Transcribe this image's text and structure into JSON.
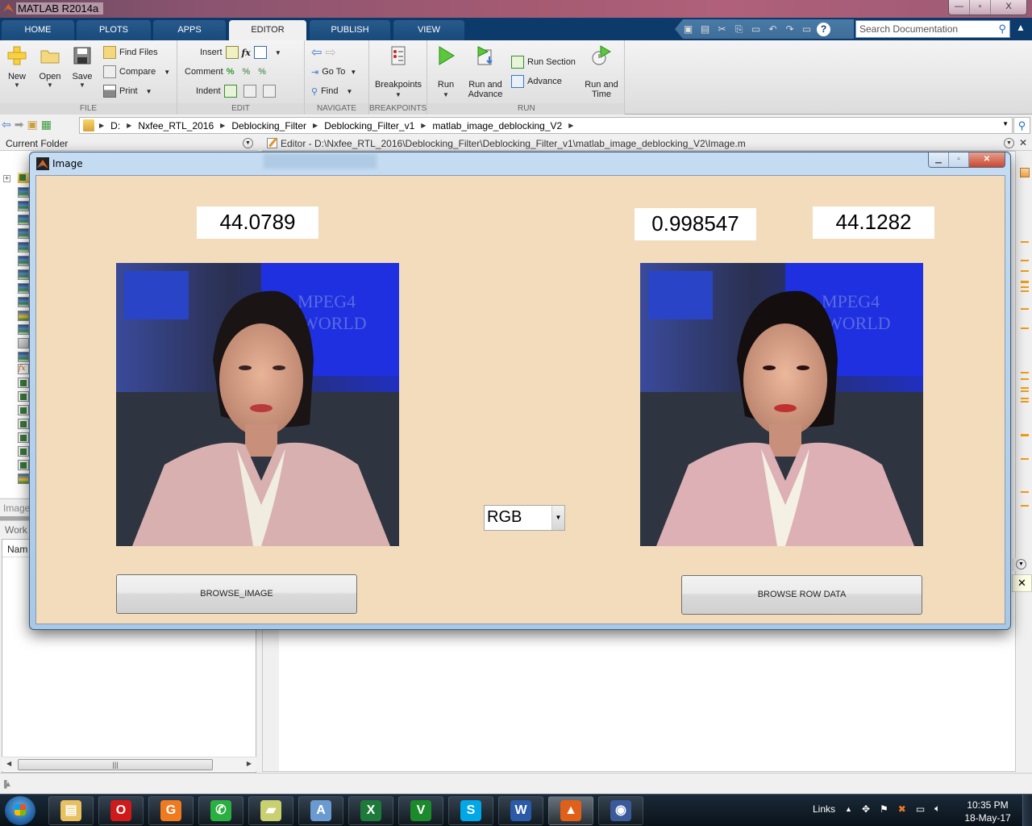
{
  "app": {
    "title": "MATLAB R2014a",
    "window_controls": {
      "minimize": "—",
      "restore": "▫",
      "close": "X"
    }
  },
  "ribbon": {
    "tabs": [
      {
        "label": "HOME",
        "active": false
      },
      {
        "label": "PLOTS",
        "active": false
      },
      {
        "label": "APPS",
        "active": false
      },
      {
        "label": "EDITOR",
        "active": true
      },
      {
        "label": "PUBLISH",
        "active": false
      },
      {
        "label": "VIEW",
        "active": false
      }
    ],
    "search_placeholder": "Search Documentation",
    "sections": {
      "file": {
        "label": "FILE",
        "new": "New",
        "open": "Open",
        "save": "Save",
        "find_files": "Find Files",
        "compare": "Compare",
        "print": "Print"
      },
      "edit": {
        "label": "EDIT",
        "insert": "Insert",
        "comment": "Comment",
        "indent": "Indent",
        "fx": "fx"
      },
      "navigate": {
        "label": "NAVIGATE",
        "go_to": "Go To",
        "find": "Find"
      },
      "breakpoints": {
        "label": "BREAKPOINTS",
        "breakpoints": "Breakpoints"
      },
      "run": {
        "label": "RUN",
        "run": "Run",
        "run_and_advance_1": "Run and",
        "run_and_advance_2": "Advance",
        "run_section": "Run Section",
        "advance": "Advance",
        "run_and_time_1": "Run and",
        "run_and_time_2": "Time"
      }
    }
  },
  "address_bar": {
    "path": [
      "D:",
      "Nxfee_RTL_2016",
      "Deblocking_Filter",
      "Deblocking_Filter_v1",
      "matlab_image_deblocking_V2"
    ]
  },
  "current_folder": {
    "title": "Current Folder",
    "details_label": "Image",
    "workspace_label": "Work",
    "workspace_column": "Nam"
  },
  "editor": {
    "title": "Editor - D:\\Nxfee_RTL_2016\\Deblocking_Filter\\Deblocking_Filter_v1\\matlab_image_deblocking_V2\\Image.m"
  },
  "figure": {
    "title": "Image",
    "background_color": "#f2dcbc",
    "left_value": "44.0789",
    "middle_value": "0.998547",
    "right_value": "44.1282",
    "color_mode": "RGB",
    "browse_image_label": "BROWSE_IMAGE",
    "browse_row_data_label": "BROWSE ROW DATA",
    "left_image_desc": "Original news anchor image",
    "right_image_desc": "Deblocked news anchor image"
  },
  "taskbar": {
    "apps": [
      {
        "name": "file-explorer",
        "glyph": "▤",
        "color": "#e8c060"
      },
      {
        "name": "opera",
        "glyph": "O",
        "color": "#d01a1a"
      },
      {
        "name": "foxit-pdf",
        "glyph": "G",
        "color": "#f07a20"
      },
      {
        "name": "whatsapp",
        "glyph": "✆",
        "color": "#2ab040"
      },
      {
        "name": "sticky-notes",
        "glyph": "▰",
        "color": "#c8d070"
      },
      {
        "name": "wordpad",
        "glyph": "A",
        "color": "#6a9ad0"
      },
      {
        "name": "excel",
        "glyph": "X",
        "color": "#1e7a3a"
      },
      {
        "name": "vim",
        "glyph": "V",
        "color": "#1a8a2a"
      },
      {
        "name": "skype",
        "glyph": "S",
        "color": "#00a8e8"
      },
      {
        "name": "word",
        "glyph": "W",
        "color": "#2a5aa8"
      },
      {
        "name": "matlab",
        "glyph": "▲",
        "color": "#e0601a"
      },
      {
        "name": "media-player",
        "glyph": "◉",
        "color": "#3a5a9a"
      }
    ],
    "links_label": "Links",
    "time": "10:35 PM",
    "date": "18-May-17"
  }
}
